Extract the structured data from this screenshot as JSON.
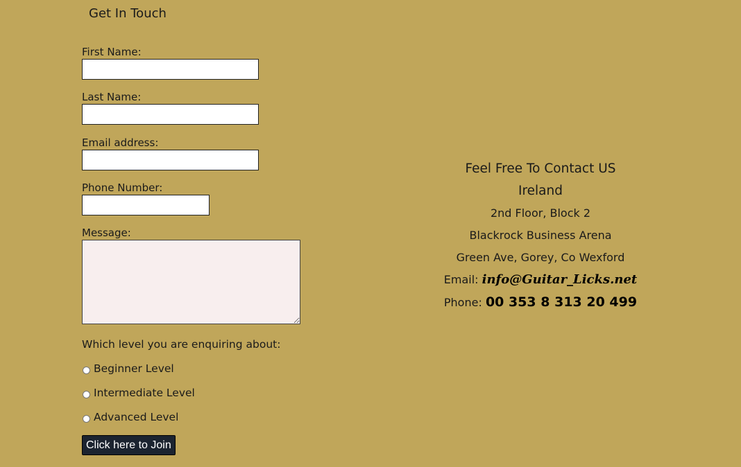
{
  "form": {
    "title": "Get In Touch",
    "first_name_label": "First Name:",
    "first_name_value": "",
    "last_name_label": "Last Name:",
    "last_name_value": "",
    "email_label": "Email address:",
    "email_value": "",
    "phone_label": "Phone Number:",
    "phone_value": "",
    "message_label": "Message:",
    "message_value": "",
    "level_question": "Which level you are enquiring about:",
    "levels": [
      {
        "label": "Beginner Level",
        "checked": false
      },
      {
        "label": "Intermediate Level",
        "checked": false
      },
      {
        "label": "Advanced Level",
        "checked": false
      }
    ],
    "submit_label": "Click here to Join"
  },
  "contact": {
    "heading": "Feel Free To Contact US",
    "country": "Ireland",
    "address_lines": [
      "2nd Floor, Block 2",
      "Blackrock Business Arena",
      "Green Ave, Gorey, Co Wexford"
    ],
    "email_label": "Email:",
    "email_value": "info@Guitar_Licks.net",
    "phone_label": "Phone:",
    "phone_value": "00 353 8 313 20 499"
  },
  "colors": {
    "page_background": "#c0a65a",
    "button_background": "#1c2430",
    "message_background": "#f8eeee"
  }
}
